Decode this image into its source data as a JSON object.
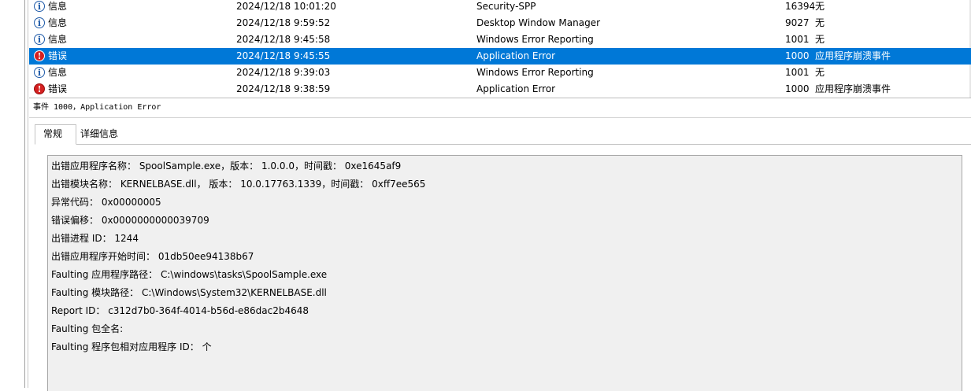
{
  "events": [
    {
      "level": "信息",
      "icon": "info",
      "date": "2024/12/18 10:01:20",
      "source": "Security-SPP",
      "event_id": "16394",
      "task": "无",
      "selected": false
    },
    {
      "level": "信息",
      "icon": "info",
      "date": "2024/12/18 9:59:52",
      "source": "Desktop Window Manager",
      "event_id": "9027",
      "task": "无",
      "selected": false
    },
    {
      "level": "信息",
      "icon": "info",
      "date": "2024/12/18 9:45:58",
      "source": "Windows Error Reporting",
      "event_id": "1001",
      "task": "无",
      "selected": false
    },
    {
      "level": "错误",
      "icon": "error",
      "date": "2024/12/18 9:45:55",
      "source": "Application Error",
      "event_id": "1000",
      "task": "应用程序崩溃事件",
      "selected": true
    },
    {
      "level": "信息",
      "icon": "info",
      "date": "2024/12/18 9:39:03",
      "source": "Windows Error Reporting",
      "event_id": "1001",
      "task": "无",
      "selected": false
    },
    {
      "level": "错误",
      "icon": "error",
      "date": "2024/12/18 9:38:59",
      "source": "Application Error",
      "event_id": "1000",
      "task": "应用程序崩溃事件",
      "selected": false
    }
  ],
  "detail": {
    "header": "事件 1000，Application Error",
    "tabs": {
      "general": "常规",
      "details": "详细信息"
    },
    "lines": [
      "出错应用程序名称： SpoolSample.exe，版本： 1.0.0.0，时间戳： 0xe1645af9",
      "出错模块名称： KERNELBASE.dll， 版本： 10.0.17763.1339，时间戳： 0xff7ee565",
      "异常代码： 0x00000005",
      "错误偏移： 0x0000000000039709",
      "出错进程 ID： 1244",
      "出错应用程序开始时间： 01db50ee94138b67",
      "Faulting 应用程序路径： C:\\windows\\tasks\\SpoolSample.exe",
      "Faulting 模块路径： C:\\Windows\\System32\\KERNELBASE.dll",
      "Report ID： c312d7b0-364f-4014-b56d-e86dac2b4648",
      "Faulting 包全名:",
      "Faulting 程序包相对应用程序 ID： 个"
    ]
  },
  "colors": {
    "selection": "#0078d7",
    "info_icon": "#1e5aa8",
    "error_icon": "#d42020"
  }
}
